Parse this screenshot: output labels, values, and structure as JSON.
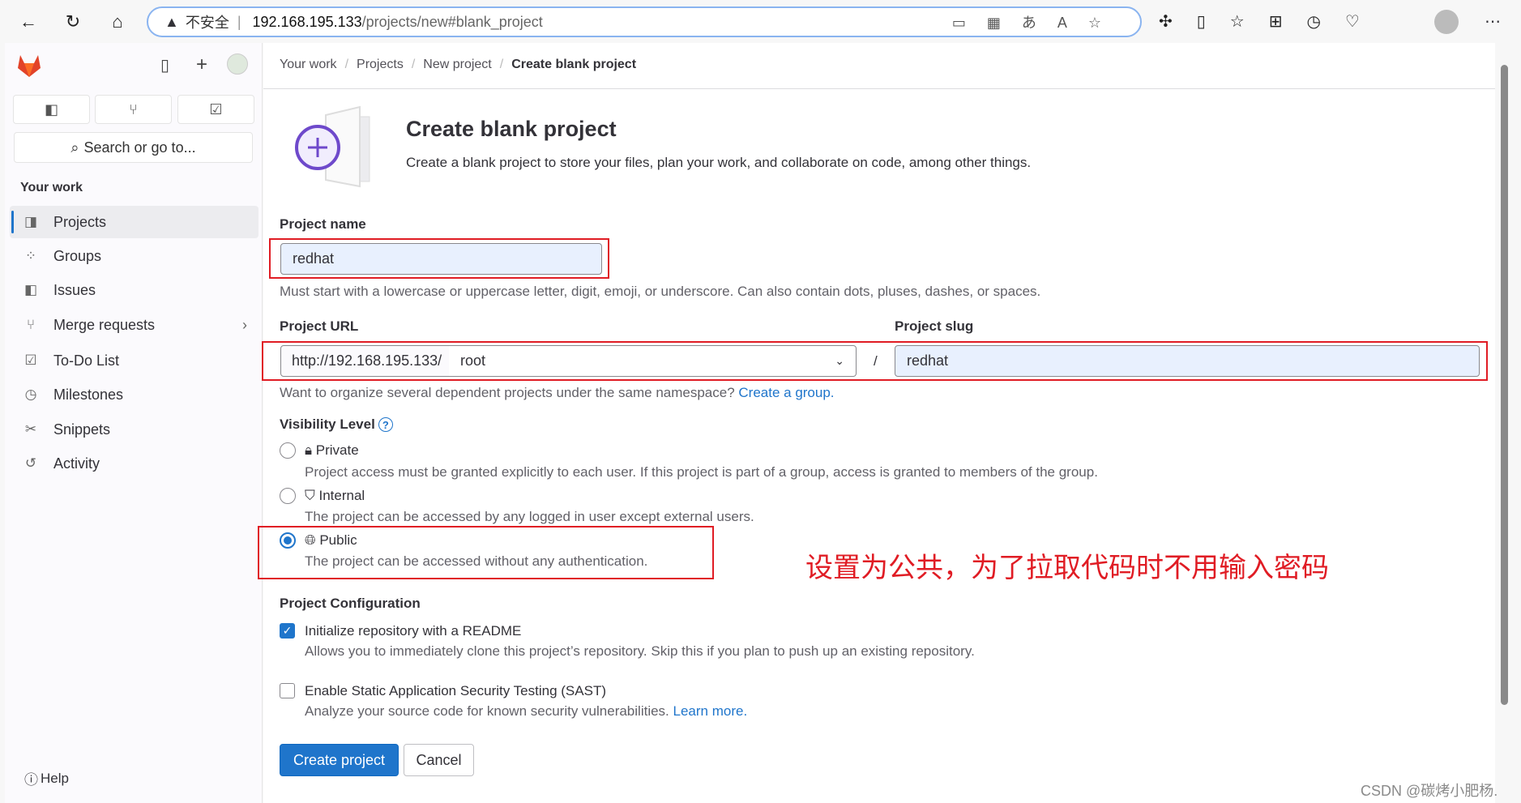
{
  "browser": {
    "security_label": "不安全",
    "url_host": "192.168.195.133",
    "url_path": "/projects/new#blank_project"
  },
  "sidebar": {
    "search_placeholder": "Search or go to...",
    "section_title": "Your work",
    "items": [
      {
        "label": "Projects",
        "icon": "project-icon"
      },
      {
        "label": "Groups",
        "icon": "group-icon"
      },
      {
        "label": "Issues",
        "icon": "issues-icon"
      },
      {
        "label": "Merge requests",
        "icon": "merge-request-icon"
      },
      {
        "label": "To-Do List",
        "icon": "todo-icon"
      },
      {
        "label": "Milestones",
        "icon": "clock-icon"
      },
      {
        "label": "Snippets",
        "icon": "scissors-icon"
      },
      {
        "label": "Activity",
        "icon": "history-icon"
      }
    ],
    "help": "Help"
  },
  "breadcrumb": [
    "Your work",
    "Projects",
    "New project",
    "Create blank project"
  ],
  "page": {
    "title": "Create blank project",
    "subtitle": "Create a blank project to store your files, plan your work, and collaborate on code, among other things.",
    "project_name_label": "Project name",
    "project_name_value": "redhat",
    "project_name_help": "Must start with a lowercase or uppercase letter, digit, emoji, or underscore. Can also contain dots, pluses, dashes, or spaces.",
    "project_url_label": "Project URL",
    "url_prefix": "http://192.168.195.133/",
    "namespace": "root",
    "slash": "/",
    "project_slug_label": "Project slug",
    "project_slug_value": "redhat",
    "namespace_hint": "Want to organize several dependent projects under the same namespace?",
    "create_group_link": "Create a group.",
    "visibility_label": "Visibility Level",
    "visibility": [
      {
        "label": "Private",
        "desc": "Project access must be granted explicitly to each user. If this project is part of a group, access is granted to members of the group.",
        "selected": false
      },
      {
        "label": "Internal",
        "desc": "The project can be accessed by any logged in user except external users.",
        "selected": false
      },
      {
        "label": "Public",
        "desc": "The project can be accessed without any authentication.",
        "selected": true
      }
    ],
    "config_label": "Project Configuration",
    "readme_label": "Initialize repository with a README",
    "readme_checked": true,
    "readme_desc": "Allows you to immediately clone this project’s repository. Skip this if you plan to push up an existing repository.",
    "sast_label": "Enable Static Application Security Testing (SAST)",
    "sast_checked": false,
    "sast_desc": "Analyze your source code for known security vulnerabilities.",
    "learn_more": "Learn more.",
    "create_button": "Create project",
    "cancel_button": "Cancel"
  },
  "annotation": "设置为公共，为了拉取代码时不用输入密码",
  "watermark": "CSDN @碳烤小肥杨.",
  "colors": {
    "accent": "#1f75cb",
    "annotation": "#e01c24"
  }
}
